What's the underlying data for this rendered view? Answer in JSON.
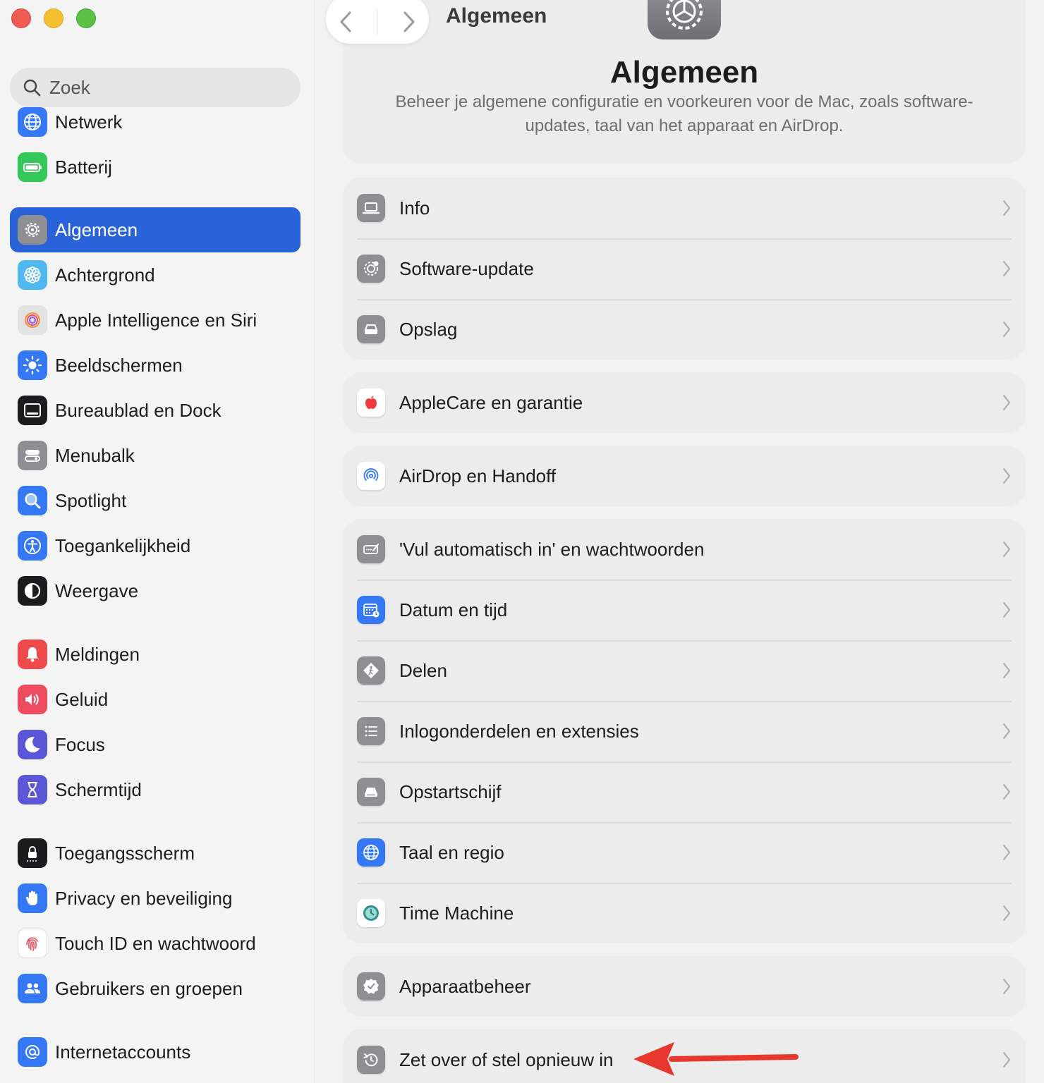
{
  "sidebar": {
    "search_placeholder": "Zoek",
    "items": [
      {
        "label": "Netwerk",
        "icon": "globe-icon",
        "color": "#3478f6"
      },
      {
        "label": "Batterij",
        "icon": "battery-icon",
        "color": "#34c759"
      },
      {
        "label": "Algemeen",
        "icon": "gear-icon",
        "color": "#8e8e93",
        "active": true
      },
      {
        "label": "Achtergrond",
        "icon": "flower-icon",
        "color": "#4fb8f0"
      },
      {
        "label": "Apple Intelligence en Siri",
        "icon": "siri-icon",
        "color": "#e3e3e3"
      },
      {
        "label": "Beeldschermen",
        "icon": "sun-icon",
        "color": "#3478f6"
      },
      {
        "label": "Bureaublad en Dock",
        "icon": "dock-icon",
        "color": "#1c1c1e"
      },
      {
        "label": "Menubalk",
        "icon": "menubar-icon",
        "color": "#8e8e93"
      },
      {
        "label": "Spotlight",
        "icon": "magnifier-icon",
        "color": "#3478f6"
      },
      {
        "label": "Toegankelijkheid",
        "icon": "accessibility-icon",
        "color": "#3478f6"
      },
      {
        "label": "Weergave",
        "icon": "appearance-icon",
        "color": "#1c1c1e"
      },
      {
        "label": "Meldingen",
        "icon": "bell-icon",
        "color": "#ef4b4b"
      },
      {
        "label": "Geluid",
        "icon": "speaker-icon",
        "color": "#ef4b5e"
      },
      {
        "label": "Focus",
        "icon": "moon-icon",
        "color": "#5b57d8"
      },
      {
        "label": "Schermtijd",
        "icon": "hourglass-icon",
        "color": "#5b57d8"
      },
      {
        "label": "Toegangsscherm",
        "icon": "lock-icon",
        "color": "#1c1c1e"
      },
      {
        "label": "Privacy en beveiliging",
        "icon": "hand-icon",
        "color": "#3478f6"
      },
      {
        "label": "Touch ID en wachtwoord",
        "icon": "fingerprint-icon",
        "color": "#ffffff"
      },
      {
        "label": "Gebruikers en groepen",
        "icon": "users-icon",
        "color": "#3478f6"
      },
      {
        "label": "Internetaccounts",
        "icon": "at-icon",
        "color": "#3478f6"
      }
    ]
  },
  "toolbar": {
    "title": "Algemeen"
  },
  "header": {
    "title": "Algemeen",
    "description": "Beheer je algemene configuratie en voorkeuren voor de Mac, zoals software-updates, taal van het apparaat en AirDrop."
  },
  "groups": [
    {
      "rows": [
        {
          "label": "Info",
          "icon": "laptop-icon",
          "color": "#8e8e93"
        },
        {
          "label": "Software-update",
          "icon": "gear-badge-icon",
          "color": "#8e8e93"
        },
        {
          "label": "Opslag",
          "icon": "drive-icon",
          "color": "#8e8e93"
        }
      ]
    },
    {
      "rows": [
        {
          "label": "AppleCare en garantie",
          "icon": "apple-icon",
          "color": "#ffffff"
        }
      ]
    },
    {
      "rows": [
        {
          "label": "AirDrop en Handoff",
          "icon": "airdrop-icon",
          "color": "#ffffff"
        }
      ]
    },
    {
      "rows": [
        {
          "label": "'Vul automatisch in' en wachtwoorden",
          "icon": "autofill-icon",
          "color": "#8e8e93"
        },
        {
          "label": "Datum en tijd",
          "icon": "calendar-clock-icon",
          "color": "#3478f6"
        },
        {
          "label": "Delen",
          "icon": "sharing-icon",
          "color": "#8e8e93"
        },
        {
          "label": "Inlogonderdelen en extensies",
          "icon": "list-icon",
          "color": "#8e8e93"
        },
        {
          "label": "Opstartschijf",
          "icon": "disk-icon",
          "color": "#8e8e93"
        },
        {
          "label": "Taal en regio",
          "icon": "globe-icon",
          "color": "#3478f6"
        },
        {
          "label": "Time Machine",
          "icon": "time-machine-icon",
          "color": "#ffffff"
        }
      ]
    },
    {
      "rows": [
        {
          "label": "Apparaatbeheer",
          "icon": "badge-check-icon",
          "color": "#8e8e93"
        }
      ]
    },
    {
      "rows": [
        {
          "label": "Zet over of stel opnieuw in",
          "icon": "reset-icon",
          "color": "#8e8e93"
        }
      ]
    }
  ],
  "annotation": {
    "arrow_color": "#e8382e"
  }
}
